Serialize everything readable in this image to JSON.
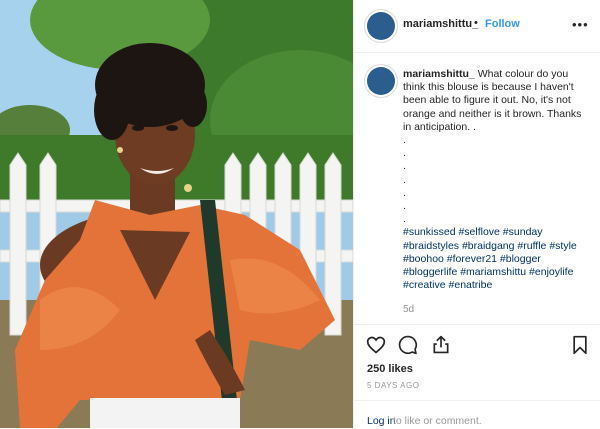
{
  "post": {
    "username": "mariamshittu_",
    "follow_dot": "•",
    "follow_label": "Follow",
    "more_label": "•••",
    "caption_username": "mariamshittu_",
    "caption_text": " What colour do you think this blouse is because I haven't been able to figure it out. No, it's not orange and neither is it brown. Thanks in anticipation. .\n.\n.\n.\n.\n.\n.\n.\n",
    "hashtags": "#sunkissed #selflove #sunday #braidstyles #braidgang #ruffle #style #boohoo #forever21 #blogger #bloggerlife #mariamshittu #enjoylife #creative #enatribe",
    "comment_age": "5d",
    "likes": "250 likes",
    "posted_ago": "5 DAYS AGO"
  },
  "icons": {
    "like": "heart-icon",
    "comment": "comment-icon",
    "share": "share-icon",
    "save": "bookmark-icon"
  },
  "footer": {
    "login_link": "Log in",
    "login_rest": "to like or comment."
  },
  "colors": {
    "link_blue": "#3897f0",
    "hashtag": "#003569",
    "muted": "#999999",
    "avatar": "#2c5d8f",
    "blouse": "#e4733a"
  }
}
